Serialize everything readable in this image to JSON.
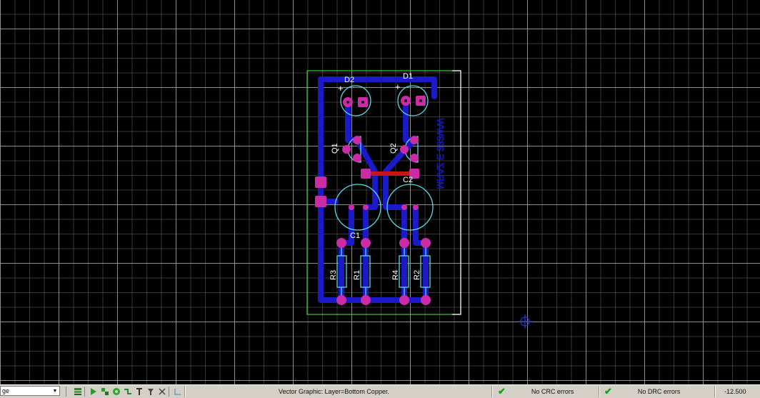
{
  "window": {
    "title": ""
  },
  "canvas": {
    "grid_visible": true
  },
  "board": {
    "component_labels": [
      "D2",
      "D1",
      "Q1",
      "Q2",
      "C2",
      "C1",
      "R3",
      "R1",
      "R4",
      "R2"
    ],
    "polarity_marks": [
      "+",
      "+"
    ],
    "mirrored_text": "MRAZ E 333WW",
    "colors": {
      "bottom_copper": "#1a1ac8",
      "top_copper": "#c81414",
      "pad": "#cc2ba6",
      "silkscreen": "#5ad7e6",
      "outline_green": "#3ccd3c",
      "outline_white": "#ffffff",
      "cursor": "#2a3ad0"
    }
  },
  "statusbar": {
    "layer_select_value": "ge",
    "status_message": "Vector Graphic: Layer=Bottom Copper.",
    "crc_status": "No CRC errors",
    "drc_status": "No DRC errors",
    "coordinate": "-12.500",
    "toolbar_icons": [
      "layers-icon",
      "route-icon",
      "component-icon",
      "pad-icon",
      "track-icon",
      "text-icon",
      "measure-icon",
      "cut-icon",
      "connect-icon"
    ]
  }
}
